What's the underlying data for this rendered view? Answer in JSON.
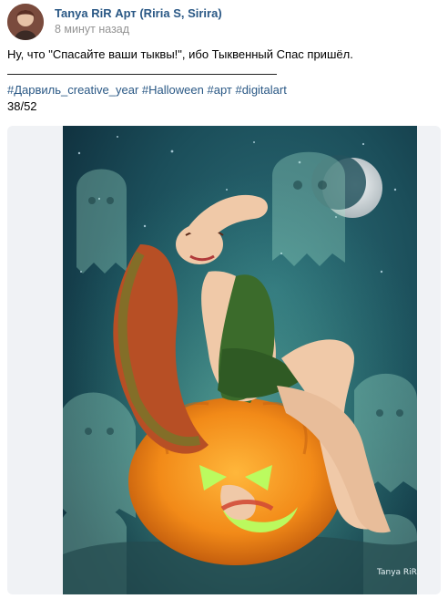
{
  "post": {
    "author": "Tanya RiR Арт (Riria S, Sirira)",
    "time": "8 минут назад",
    "text_line1": "Ну, что \"Спасайте ваши тыквы!\", ибо Тыквенный Спас пришёл.",
    "hashtags": [
      "#Дарвиль_creative_year",
      "#Halloween",
      "#арт",
      "#digitalart"
    ],
    "counter": "38/52"
  },
  "artwork": {
    "signature": "Tanya RiR"
  },
  "colors": {
    "link": "#2a5885",
    "muted": "#939393",
    "bg_media": "#f0f2f5"
  }
}
